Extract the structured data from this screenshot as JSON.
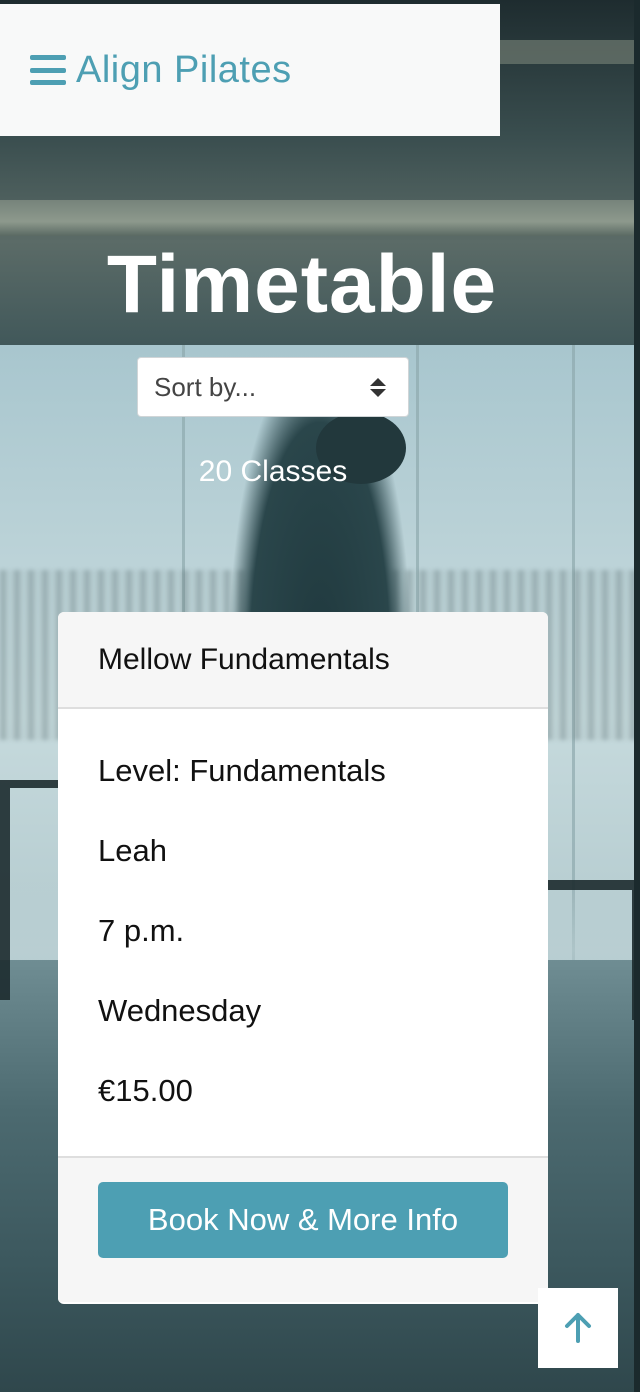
{
  "header": {
    "brand": "Align Pilates",
    "menu_icon": "hamburger-menu-icon",
    "accent_color": "#4d9fb3"
  },
  "hero": {
    "title": "Timetable",
    "sort": {
      "selected": "Sort by...",
      "icon": "select-arrows-icon"
    },
    "class_count": "20 Classes"
  },
  "card": {
    "title": "Mellow Fundamentals",
    "level": "Level: Fundamentals",
    "instructor": "Leah",
    "time": "7 p.m.",
    "day": "Wednesday",
    "price": "€15.00",
    "button_label": "Book Now & More Info"
  },
  "back_to_top": {
    "icon": "arrow-up-icon"
  }
}
